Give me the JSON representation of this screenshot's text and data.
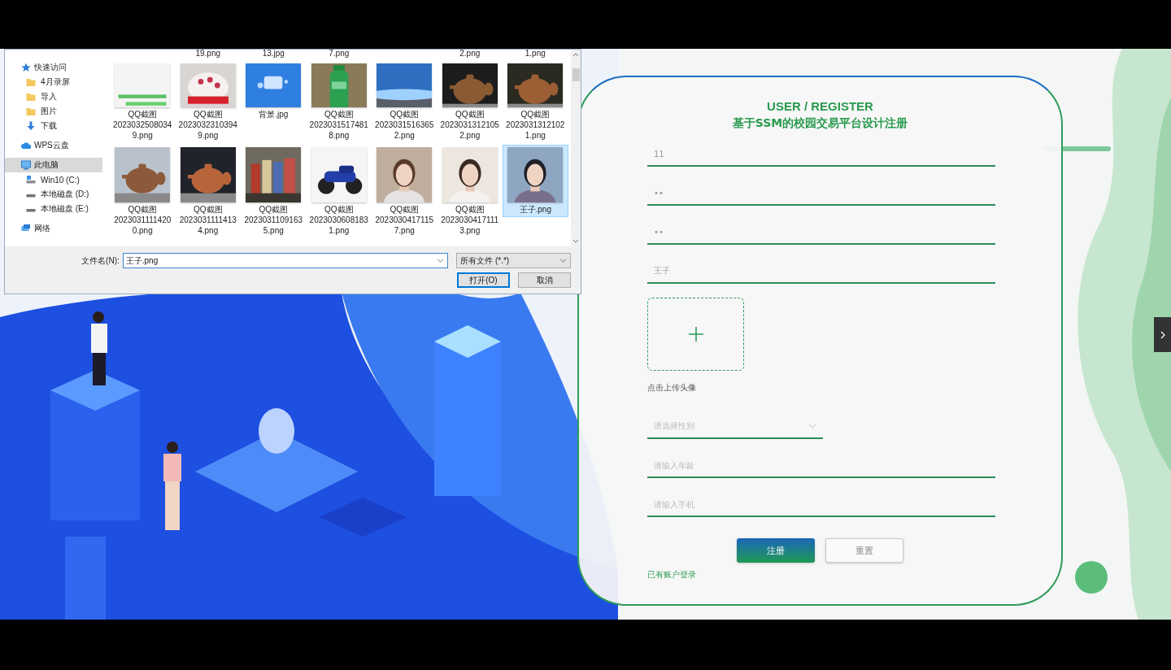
{
  "dialog": {
    "sidebar": [
      {
        "label": "快速访问",
        "kind": "star",
        "selected": false,
        "children": [
          {
            "label": "4月录屏",
            "kind": "folder",
            "selected": false
          },
          {
            "label": "导入",
            "kind": "folder",
            "selected": false
          },
          {
            "label": "图片",
            "kind": "folder",
            "selected": false
          },
          {
            "label": "下载",
            "kind": "download",
            "selected": false
          }
        ]
      },
      {
        "label": "WPS云盘",
        "kind": "cloud",
        "selected": false
      },
      {
        "label": "此电脑",
        "kind": "computer",
        "selected": true,
        "children": [
          {
            "label": "Win10 (C:)",
            "kind": "system_drive",
            "selected": false
          },
          {
            "label": "本地磁盘 (D:)",
            "kind": "drive",
            "selected": false
          },
          {
            "label": "本地磁盘 (E:)",
            "kind": "drive",
            "selected": false
          }
        ]
      },
      {
        "label": "网络",
        "kind": "network",
        "selected": false
      }
    ],
    "cut_row": [
      "19.png",
      "13.jpg",
      "7.png",
      "2.png",
      "1.png"
    ],
    "files": [
      {
        "lines": [
          "QQ截图",
          "2023032508034",
          "9.png"
        ],
        "selected": false
      },
      {
        "lines": [
          "QQ截图",
          "2023032310394",
          "9.png"
        ],
        "selected": false
      },
      {
        "lines": [
          "背景.jpg"
        ],
        "selected": false
      },
      {
        "lines": [
          "QQ截图",
          "2023031517481",
          "8.png"
        ],
        "selected": false
      },
      {
        "lines": [
          "QQ截图",
          "2023031516365",
          "2.png"
        ],
        "selected": false
      },
      {
        "lines": [
          "QQ截图",
          "2023031312105",
          "2.png"
        ],
        "selected": false
      },
      {
        "lines": [
          "QQ截图",
          "2023031312102",
          "1.png"
        ],
        "selected": false
      },
      {
        "lines": [
          "QQ截图",
          "2023031111420",
          "0.png"
        ],
        "selected": false
      },
      {
        "lines": [
          "QQ截图",
          "2023031111413",
          "4.png"
        ],
        "selected": false
      },
      {
        "lines": [
          "QQ截图",
          "2023031109163",
          "5.png"
        ],
        "selected": false
      },
      {
        "lines": [
          "QQ截图",
          "2023030608183",
          "1.png"
        ],
        "selected": false
      },
      {
        "lines": [
          "QQ截图",
          "2023030417115",
          "7.png"
        ],
        "selected": false
      },
      {
        "lines": [
          "QQ截图",
          "2023030417111",
          "3.png"
        ],
        "selected": false
      },
      {
        "lines": [
          "王子.png"
        ],
        "selected": true
      }
    ],
    "filename_label": "文件名(N):",
    "filename_value": "王子.png",
    "filter": "所有文件 (*.*)",
    "buttons": [
      {
        "label": "打开(O)",
        "default": true
      },
      {
        "label": "取消",
        "default": false
      }
    ]
  },
  "form": {
    "title": "USER / REGISTER",
    "subtitle": "基于SSM的校园交易平台设计注册",
    "fields": [
      {
        "kind": "text",
        "value": "11"
      },
      {
        "kind": "text",
        "value": "••"
      },
      {
        "kind": "text",
        "value": "••"
      },
      {
        "kind": "text",
        "value": "王子"
      },
      {
        "kind": "upload",
        "caption": "点击上传头像"
      },
      {
        "kind": "select",
        "placeholder": "请选择性别"
      },
      {
        "kind": "text",
        "placeholder": "请输入年龄"
      },
      {
        "kind": "text",
        "placeholder": "请输入手机"
      }
    ],
    "buttons": [
      {
        "label": "注册",
        "primary": true
      },
      {
        "label": "重置",
        "primary": false
      }
    ],
    "login_link": "已有账户登录"
  }
}
